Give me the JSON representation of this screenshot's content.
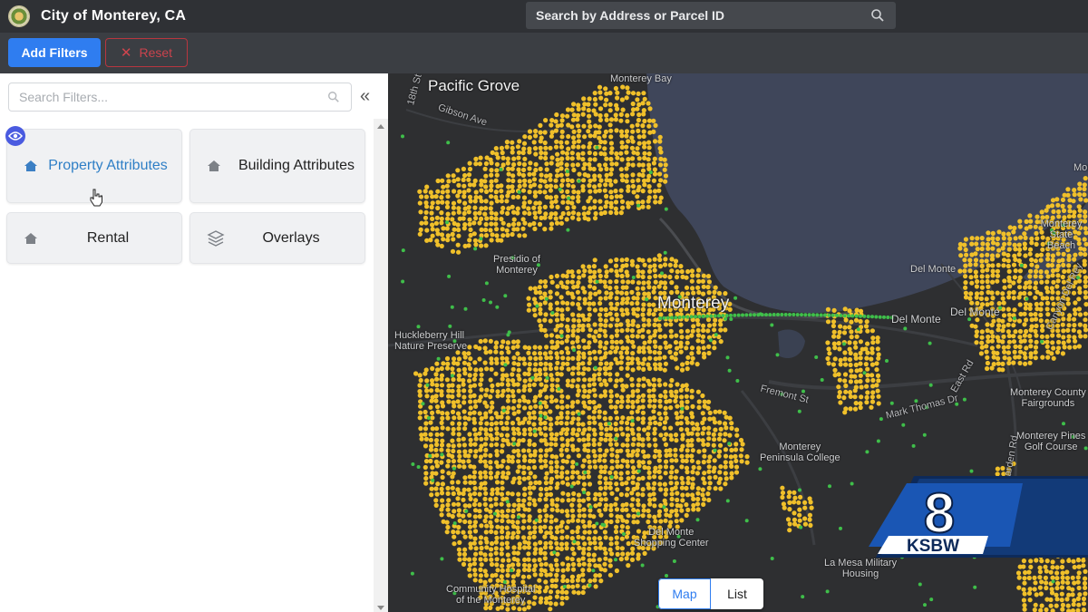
{
  "header": {
    "title": "City of Monterey, CA",
    "search_placeholder": "Search by Address or Parcel ID"
  },
  "actions": {
    "add_filters": "Add Filters",
    "reset": "Reset"
  },
  "sidebar": {
    "filter_search_placeholder": "Search Filters...",
    "collapse_glyph": "«",
    "cards": [
      {
        "label": "Property Attributes",
        "icon": "home-icon",
        "active": true
      },
      {
        "label": "Building Attributes",
        "icon": "home-icon",
        "active": false
      },
      {
        "label": "Rental",
        "icon": "home-icon",
        "active": false
      },
      {
        "label": "Overlays",
        "icon": "layers-icon",
        "active": false
      }
    ]
  },
  "map": {
    "labels": {
      "pacific_grove": "Pacific Grove",
      "monterey": "Monterey",
      "presidio": "Presidio of\nMonterey",
      "huckleberry": "Huckleberry Hill\nNature Preserve",
      "del_monte_1": "Del Monte",
      "del_monte_2": "Del Monte",
      "del_monte_3": "Del Monte",
      "monterey_state_beach": "Monterey\nState Beach",
      "peninsula_college": "Monterey\nPeninsula College",
      "fairgrounds": "Monterey County\nFairgrounds",
      "pines_golf": "Monterey Pines\nGolf Course",
      "shopping_center": "Del Monte\nShopping Center",
      "military_housing": "La Mesa Military\nHousing",
      "community_hospital": "Community Hospital\nof the Monterey",
      "monterey_bay": "Monterey Bay",
      "monte": "Monte"
    },
    "roads": {
      "gibson": "Gibson Ave",
      "fremont": "Fremont St",
      "mark_thomas": "Mark Thomas Dr",
      "garden": "Garden Rd",
      "east_rd": "East Rd",
      "th18": "18th St",
      "canyon": "Canyon Del Rey"
    },
    "colors": {
      "background": "#2e2f31",
      "water": "#3f465a",
      "parcel": "#f0c02a",
      "green_dot": "#3fbf4a"
    },
    "view_toggle": {
      "map": "Map",
      "list": "List",
      "active": "Map"
    }
  },
  "watermark": {
    "channel_number": "8",
    "channel_name": "KSBW"
  }
}
